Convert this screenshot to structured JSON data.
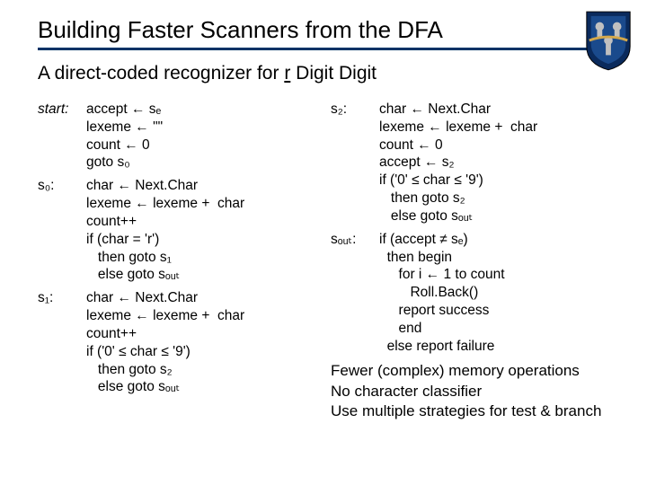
{
  "title": "Building Faster Scanners from the DFA",
  "subtitle_a": "A direct-coded recognizer for ",
  "subtitle_b": "r",
  "subtitle_c": " Digit Digit",
  "left": {
    "start_label": "start:",
    "start_body": "accept ← sₑ\nlexeme ← \"\"\ncount ← 0\ngoto s₀",
    "s0_label": "s₀:",
    "s0_body": "char ← Next.Char\nlexeme ← lexeme +  char\ncount++\nif (char = 'r')\n   then goto s₁\n   else goto sₒᵤₜ",
    "s1_label": "s₁:",
    "s1_body": "char ← Next.Char\nlexeme ← lexeme +  char\ncount++\nif ('0' ≤ char ≤ '9')\n   then goto s₂\n   else goto sₒᵤₜ"
  },
  "right": {
    "s2_label": "s₂:",
    "s2_body": "char ← Next.Char\nlexeme ← lexeme +  char\ncount ← 0\naccept ← s₂\nif ('0' ≤ char ≤ '9')\n   then goto s₂\n   else goto sₒᵤₜ",
    "sout_label": "sₒᵤₜ:",
    "sout_body": "if (accept ≠ sₑ)\n  then begin\n     for i ← 1 to count\n        Roll.Back()\n     report success\n     end\n  else report failure"
  },
  "notes": {
    "n1": "Fewer (complex) memory operations",
    "n2": "No character classifier",
    "n3": "Use multiple strategies for test & branch"
  }
}
